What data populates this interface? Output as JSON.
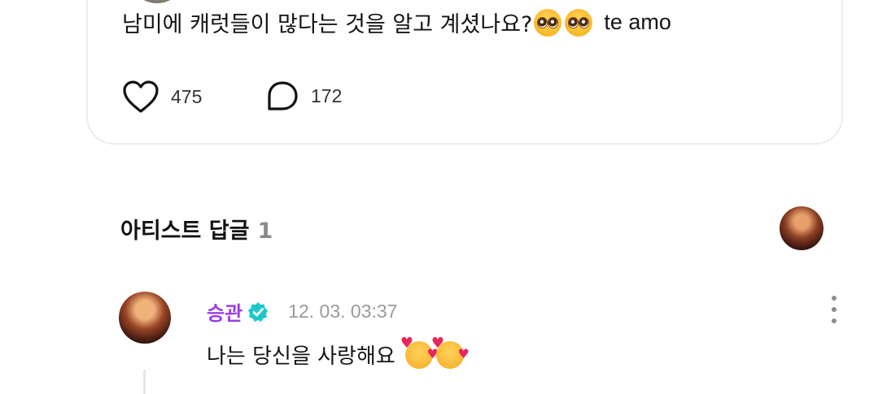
{
  "post": {
    "text": "남미에 캐럿들이 많다는 것을 알고 계셨나요?",
    "text_tail": "te amo",
    "emojis": [
      "pleading-face-emoji",
      "pleading-face-emoji"
    ],
    "likes": "475",
    "comments": "172"
  },
  "artist_replies": {
    "title": "아티스트 답글",
    "count": "1"
  },
  "reply": {
    "author": "승관",
    "timestamp": "12. 03. 03:37",
    "text": "나는 당신을 사랑해요",
    "emojis": [
      "smiling-face-with-hearts-emoji",
      "smiling-face-with-hearts-emoji"
    ],
    "verified_color": "#1fc8c8",
    "author_color": "#9b3ee0"
  }
}
